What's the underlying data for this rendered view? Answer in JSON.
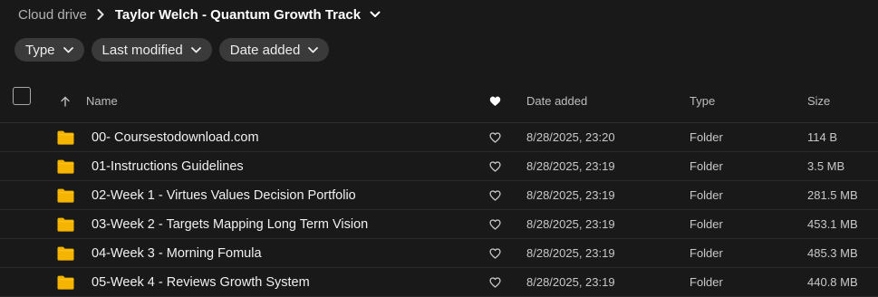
{
  "breadcrumb": {
    "root": "Cloud drive",
    "current": "Taylor Welch - Quantum Growth Track"
  },
  "filters": [
    {
      "label": "Type"
    },
    {
      "label": "Last modified"
    },
    {
      "label": "Date added"
    }
  ],
  "columns": {
    "name": "Name",
    "date_added": "Date added",
    "type": "Type",
    "size": "Size"
  },
  "rows": [
    {
      "name": "00- Coursestodownload.com",
      "date_added": "8/28/2025, 23:20",
      "type": "Folder",
      "size": "114 B"
    },
    {
      "name": "01-Instructions Guidelines",
      "date_added": "8/28/2025, 23:19",
      "type": "Folder",
      "size": "3.5 MB"
    },
    {
      "name": "02-Week 1 - Virtues Values Decision Portfolio",
      "date_added": "8/28/2025, 23:19",
      "type": "Folder",
      "size": "281.5 MB"
    },
    {
      "name": "03-Week 2 - Targets Mapping Long Term Vision",
      "date_added": "8/28/2025, 23:19",
      "type": "Folder",
      "size": "453.1 MB"
    },
    {
      "name": "04-Week 3 - Morning Fomula",
      "date_added": "8/28/2025, 23:19",
      "type": "Folder",
      "size": "485.3 MB"
    },
    {
      "name": "05-Week 4 - Reviews Growth System",
      "date_added": "8/28/2025, 23:19",
      "type": "Folder",
      "size": "440.8 MB"
    }
  ],
  "colors": {
    "background": "#191919",
    "chip": "#3a3a3a",
    "folder": "#f5b400"
  },
  "icons": {
    "folder": "folder-icon",
    "favourite": "heart-icon",
    "sort": "arrow-up-icon",
    "dropdown": "chevron-down-icon",
    "separator": "chevron-right-icon"
  }
}
